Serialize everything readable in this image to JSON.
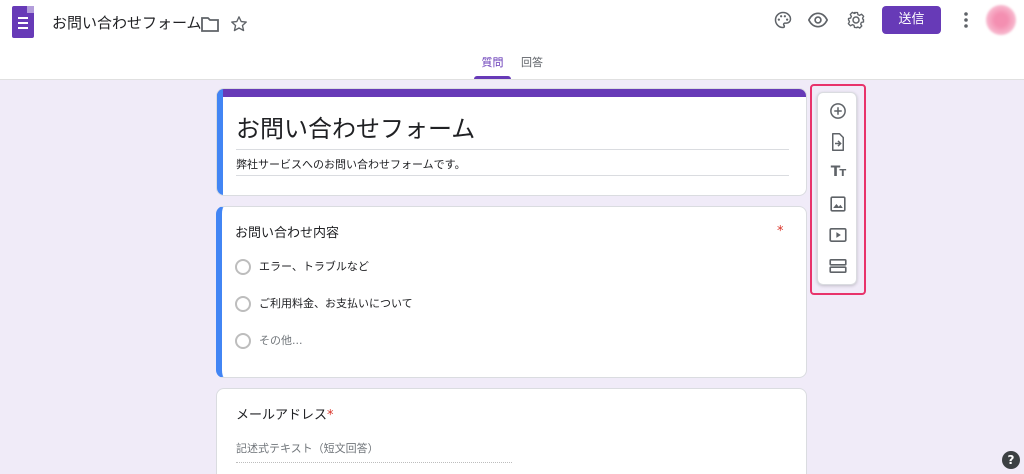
{
  "header": {
    "form_title": "お問い合わせフォーム",
    "send_label": "送信",
    "icons": [
      "forms-logo-icon",
      "folder-icon",
      "star-icon",
      "palette-icon",
      "preview-eye-icon",
      "settings-gear-icon",
      "more-vert-icon",
      "account-avatar"
    ]
  },
  "tabs": [
    {
      "label": "質問",
      "active": true
    },
    {
      "label": "回答",
      "active": false
    }
  ],
  "title_card": {
    "title": "お問い合わせフォーム",
    "description": "弊社サービスへのお問い合わせフォームです。"
  },
  "question1": {
    "title": "お問い合わせ内容",
    "required_mark": "*",
    "options": [
      "エラー、トラブルなど",
      "ご利用料金、お支払いについて",
      "その他..."
    ]
  },
  "question2": {
    "title": "メールアドレス",
    "required_mark": "*",
    "placeholder": "記述式テキスト（短文回答）"
  },
  "toolbar": {
    "tools": [
      "add-question-icon",
      "import-questions-icon",
      "add-title-icon",
      "add-image-icon",
      "add-video-icon",
      "add-section-icon"
    ],
    "title_glyph_big": "T",
    "title_glyph_small": "T"
  },
  "help_label": "?",
  "colors": {
    "brand": "#673ab7",
    "background": "#f0ebf8",
    "accent_blue": "#4285f4",
    "required": "#d93025",
    "highlight": "#e8336b"
  }
}
